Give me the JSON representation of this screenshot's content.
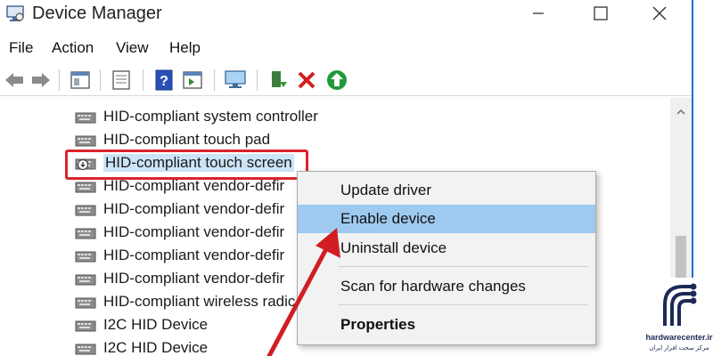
{
  "window": {
    "title": "Device Manager"
  },
  "menu": {
    "file": "File",
    "action": "Action",
    "view": "View",
    "help": "Help"
  },
  "toolbar": {
    "buttons": [
      "back-icon",
      "forward-icon",
      "properties-pane-icon",
      "properties-icon",
      "help-icon",
      "action-pane-icon",
      "scan-hardware-icon",
      "update-driver-icon",
      "uninstall-icon",
      "enable-icon"
    ]
  },
  "tree": {
    "items": [
      {
        "label": "HID-compliant system controller"
      },
      {
        "label": "HID-compliant touch pad"
      },
      {
        "label": "HID-compliant touch screen"
      },
      {
        "label": "HID-compliant vendor-defir"
      },
      {
        "label": "HID-compliant vendor-defir"
      },
      {
        "label": "HID-compliant vendor-defir"
      },
      {
        "label": "HID-compliant vendor-defir"
      },
      {
        "label": "HID-compliant vendor-defir"
      },
      {
        "label": "HID-compliant wireless radic"
      },
      {
        "label": "I2C HID Device"
      },
      {
        "label": "I2C HID Device"
      }
    ]
  },
  "context_menu": {
    "update_driver": "Update driver",
    "enable_device": "Enable device",
    "uninstall_device": "Uninstall device",
    "scan": "Scan for hardware changes",
    "properties": "Properties"
  },
  "watermark": {
    "site": "hardwarecenter.ir",
    "tagline": "مرکز سخت افزار ایران"
  },
  "colors": {
    "highlight_border": "#d9252a",
    "menu_hot": "#9ecaf0",
    "window_accent": "#1f6fd6",
    "arrow": "#d01e24"
  }
}
